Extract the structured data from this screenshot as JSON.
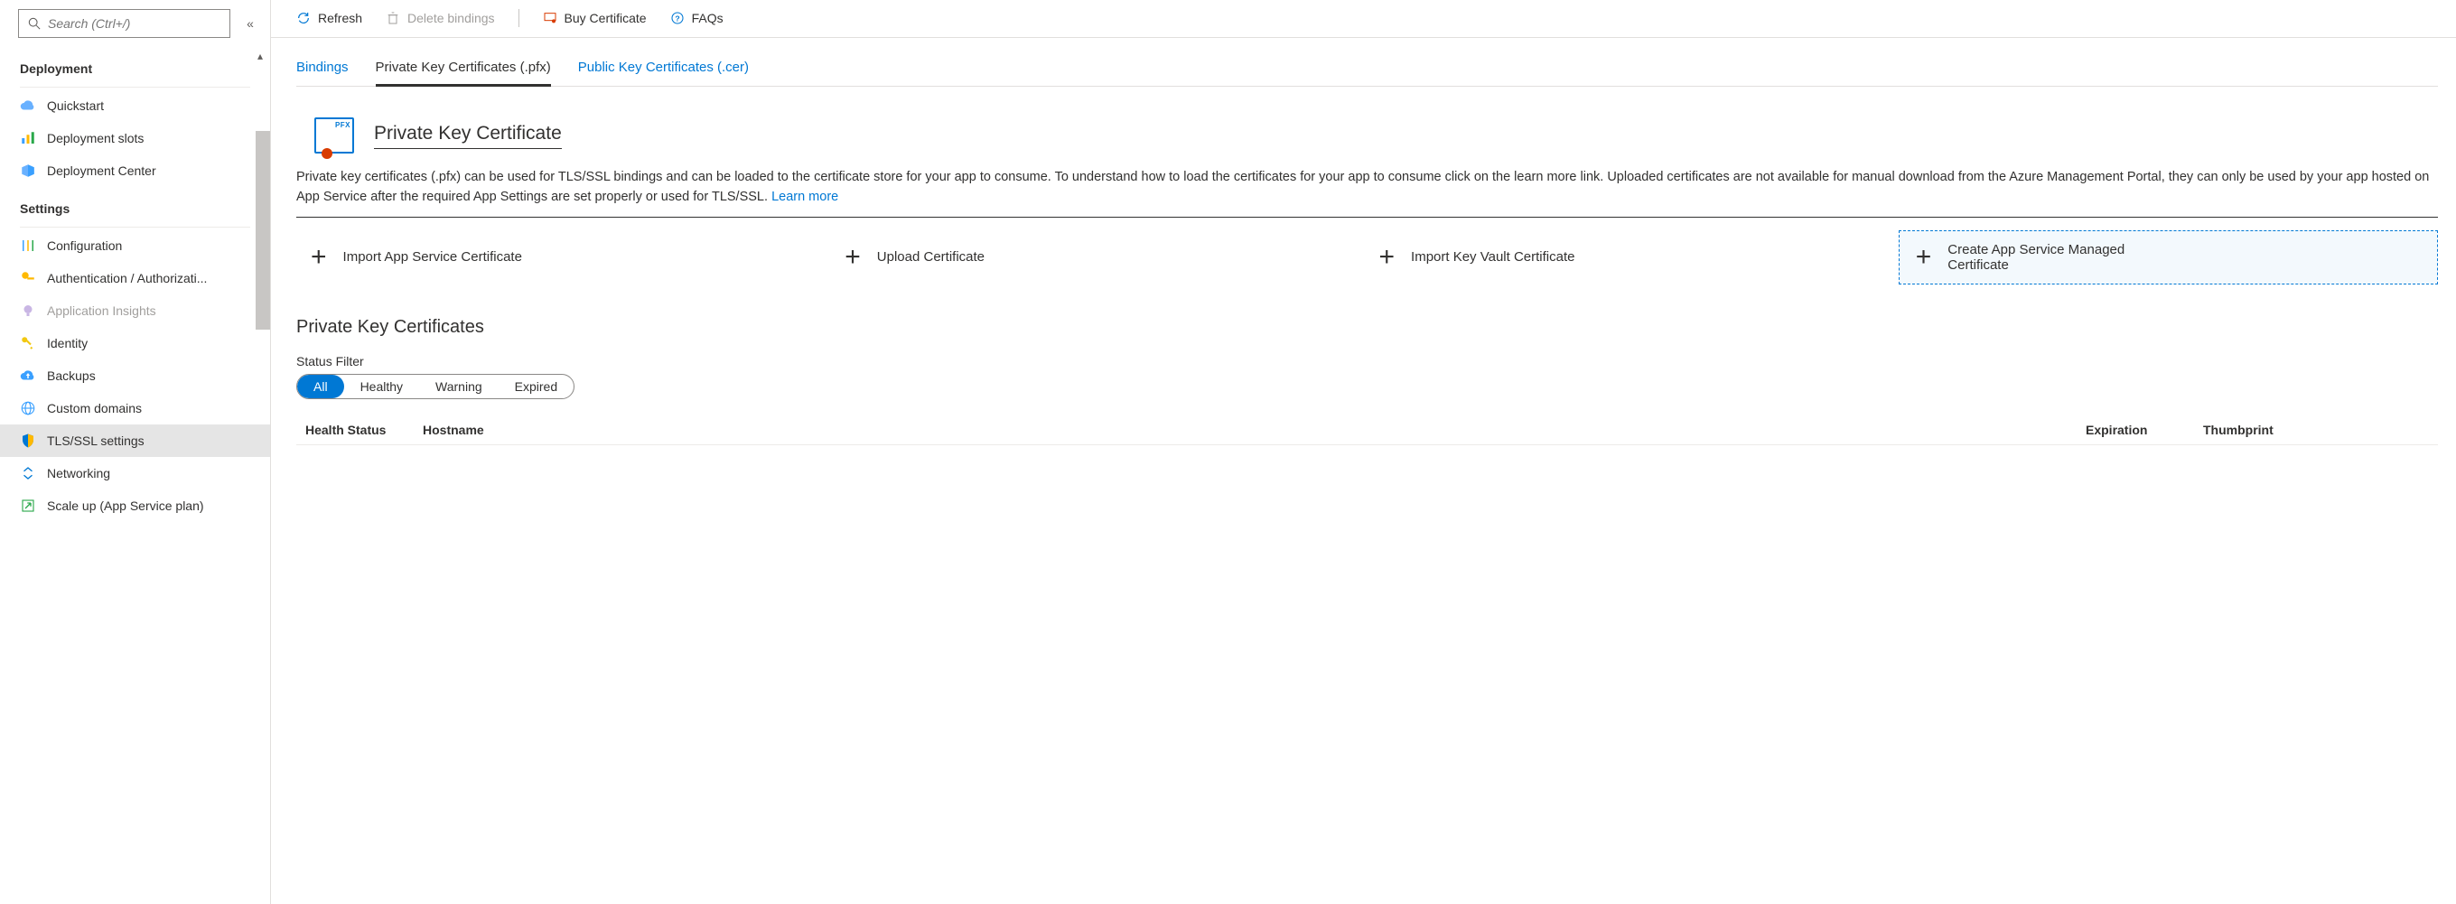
{
  "sidebar": {
    "search_placeholder": "Search (Ctrl+/)",
    "sections": {
      "deployment": {
        "header": "Deployment",
        "items": [
          {
            "label": "Quickstart"
          },
          {
            "label": "Deployment slots"
          },
          {
            "label": "Deployment Center"
          }
        ]
      },
      "settings": {
        "header": "Settings",
        "items": [
          {
            "label": "Configuration"
          },
          {
            "label": "Authentication / Authorizati..."
          },
          {
            "label": "Application Insights",
            "muted": true
          },
          {
            "label": "Identity"
          },
          {
            "label": "Backups"
          },
          {
            "label": "Custom domains"
          },
          {
            "label": "TLS/SSL settings",
            "selected": true
          },
          {
            "label": "Networking"
          },
          {
            "label": "Scale up (App Service plan)"
          }
        ]
      }
    }
  },
  "toolbar": {
    "refresh": "Refresh",
    "delete_bindings": "Delete bindings",
    "buy_certificate": "Buy Certificate",
    "faqs": "FAQs"
  },
  "tabs": {
    "bindings": "Bindings",
    "private": "Private Key Certificates (.pfx)",
    "public": "Public Key Certificates (.cer)"
  },
  "hero": {
    "badge_text": "PFX",
    "title": "Private Key Certificate"
  },
  "description": {
    "text": "Private key certificates (.pfx) can be used for TLS/SSL bindings and can be loaded to the certificate store for your app to consume. To understand how to load the certificates for your app to consume click on the learn more link. Uploaded certificates are not available for manual download from the Azure Management Portal, they can only be used by your app hosted on App Service after the required App Settings are set properly or used for TLS/SSL. ",
    "learn_more": "Learn more"
  },
  "actions": {
    "import_asc": "Import App Service Certificate",
    "upload": "Upload Certificate",
    "import_kv": "Import Key Vault Certificate",
    "create_managed": "Create App Service Managed Certificate"
  },
  "list": {
    "title": "Private Key Certificates",
    "filter_label": "Status Filter",
    "filters": [
      "All",
      "Healthy",
      "Warning",
      "Expired"
    ],
    "columns": {
      "health": "Health Status",
      "hostname": "Hostname",
      "expiration": "Expiration",
      "thumbprint": "Thumbprint"
    }
  },
  "colors": {
    "accent": "#0078d4",
    "muted": "#a19f9d",
    "orange": "#d83b01",
    "green": "#2aa84a",
    "yellow": "#f2c811"
  }
}
